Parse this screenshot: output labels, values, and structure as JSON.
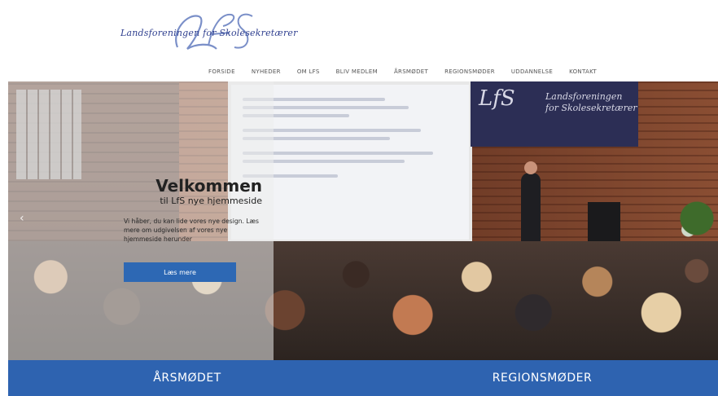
{
  "brand": {
    "monogram": "LfS",
    "name": "Landsforeningen for Skolesekretærer"
  },
  "nav": {
    "items": [
      "FORSIDE",
      "NYHEDER",
      "OM LFS",
      "BLIV MEDLEM",
      "ÅRSMØDET",
      "REGIONSMØDER",
      "UDDANNELSE",
      "KONTAKT"
    ]
  },
  "hero": {
    "title": "Velkommen",
    "subtitle": "til LfS nye hjemmeside",
    "text": "Vi håber, du kan lide vores nye design. Læs mere om udgivelsen af vores nye hjemmeside herunder",
    "button": "Læs mere",
    "prev_arrow": "‹",
    "banner_monogram": "LfS",
    "banner_line1": "Landsforeningen",
    "banner_line2": "for Skolesekretærer"
  },
  "bottom_bar": {
    "left": "ÅRSMØDET",
    "right": "REGIONSMØDER"
  },
  "colors": {
    "accent": "#2e63b0",
    "button": "#2d68b4",
    "brand_script": "#2f3f8f"
  }
}
